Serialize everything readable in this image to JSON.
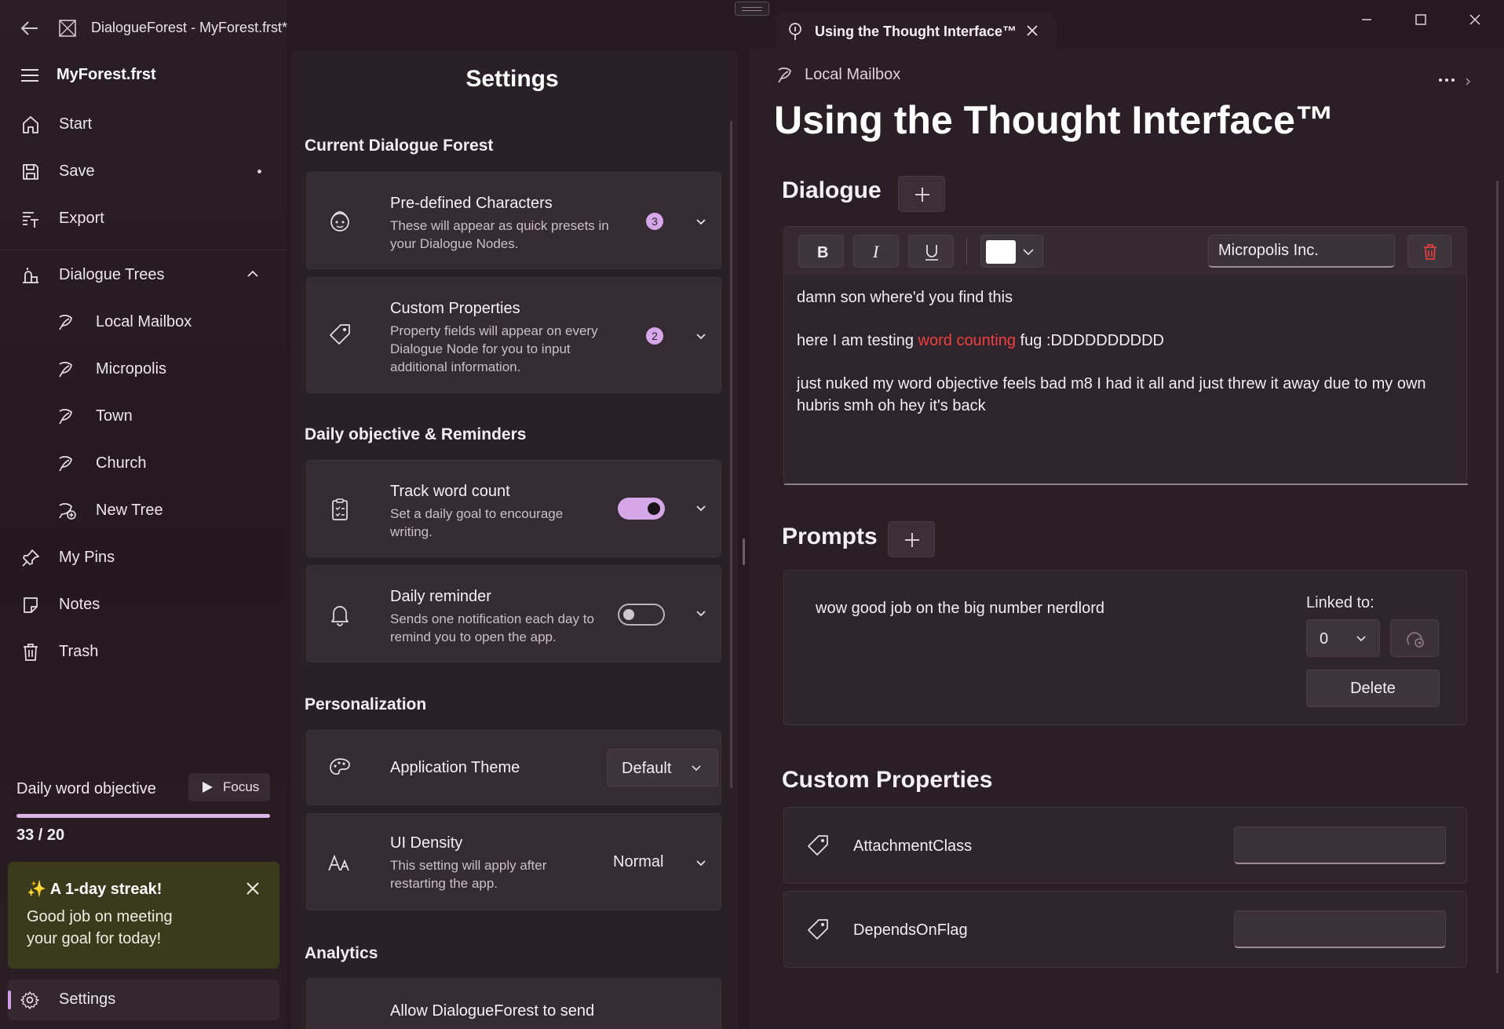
{
  "app": {
    "window_title": "DialogueForest - MyForest.frst*",
    "file_name": "MyForest.frst"
  },
  "nav": {
    "items": [
      {
        "label": "Start",
        "icon": "home-icon"
      },
      {
        "label": "Save",
        "icon": "save-icon"
      },
      {
        "label": "Export",
        "icon": "export-icon"
      }
    ],
    "trees_label": "Dialogue Trees",
    "trees": [
      {
        "label": "Local Mailbox"
      },
      {
        "label": "Micropolis"
      },
      {
        "label": "Town"
      },
      {
        "label": "Church"
      },
      {
        "label": "New Tree"
      }
    ],
    "bottom_items": [
      {
        "label": "My Pins",
        "icon": "pin-icon"
      },
      {
        "label": "Notes",
        "icon": "note-icon"
      },
      {
        "label": "Trash",
        "icon": "trash-icon"
      }
    ],
    "word_objective": {
      "label": "Daily word objective",
      "focus_label": "Focus",
      "progress_text": "33 / 20",
      "progress_fraction": 1.0
    },
    "streak": {
      "title": "✨ A 1-day streak!",
      "message": "Good job on meeting your goal for today!"
    },
    "settings_label": "Settings"
  },
  "settings": {
    "title": "Settings",
    "sections": {
      "forest": "Current Dialogue Forest",
      "daily": "Daily objective & Reminders",
      "personalization": "Personalization",
      "analytics": "Analytics"
    },
    "characters": {
      "title": "Pre-defined Characters",
      "desc": "These will appear as quick presets in your Dialogue Nodes.",
      "count": "3"
    },
    "custom_props": {
      "title": "Custom Properties",
      "desc": "Property fields will appear on every Dialogue Node for you to input additional information.",
      "count": "2"
    },
    "track_words": {
      "title": "Track word count",
      "desc": "Set a daily goal to encourage writing.",
      "enabled": true
    },
    "reminder": {
      "title": "Daily reminder",
      "desc": "Sends one notification each day to remind you to open the app.",
      "enabled": false
    },
    "theme": {
      "title": "Application Theme",
      "value": "Default"
    },
    "density": {
      "title": "UI Density",
      "desc": "This setting will apply after restarting the app.",
      "value": "Normal"
    },
    "analytics_item": {
      "title": "Allow DialogueForest to send"
    }
  },
  "editor": {
    "tab_title": "Using the Thought Interface™",
    "breadcrumb": "Local Mailbox",
    "page_title": "Using the Thought Interface™",
    "dialogue_heading": "Dialogue",
    "character_value": "Micropolis Inc.",
    "text_color": "#ffffff",
    "dialogue_lines": {
      "line1": "damn son where'd you find this",
      "line2_pre": "here I am testing ",
      "line2_red": "word counting",
      "line2_post": " fug :DDDDDDDDDD",
      "line3": "just nuked my word objective feels bad m8 I had it all and just threw it away due to my own hubris smh oh hey it's back"
    },
    "prompts_heading": "Prompts",
    "prompt": {
      "text": "wow good job on the big number nerdlord",
      "linked_label": "Linked to:",
      "linked_value": "0",
      "delete_label": "Delete"
    },
    "custom_properties_heading": "Custom Properties",
    "properties": [
      {
        "name": "AttachmentClass",
        "value": ""
      },
      {
        "name": "DependsOnFlag",
        "value": ""
      }
    ]
  },
  "colors": {
    "accent": "#d6a7e8",
    "highlight_red": "#f0413f",
    "streak_bg": "#3a3b1d"
  }
}
